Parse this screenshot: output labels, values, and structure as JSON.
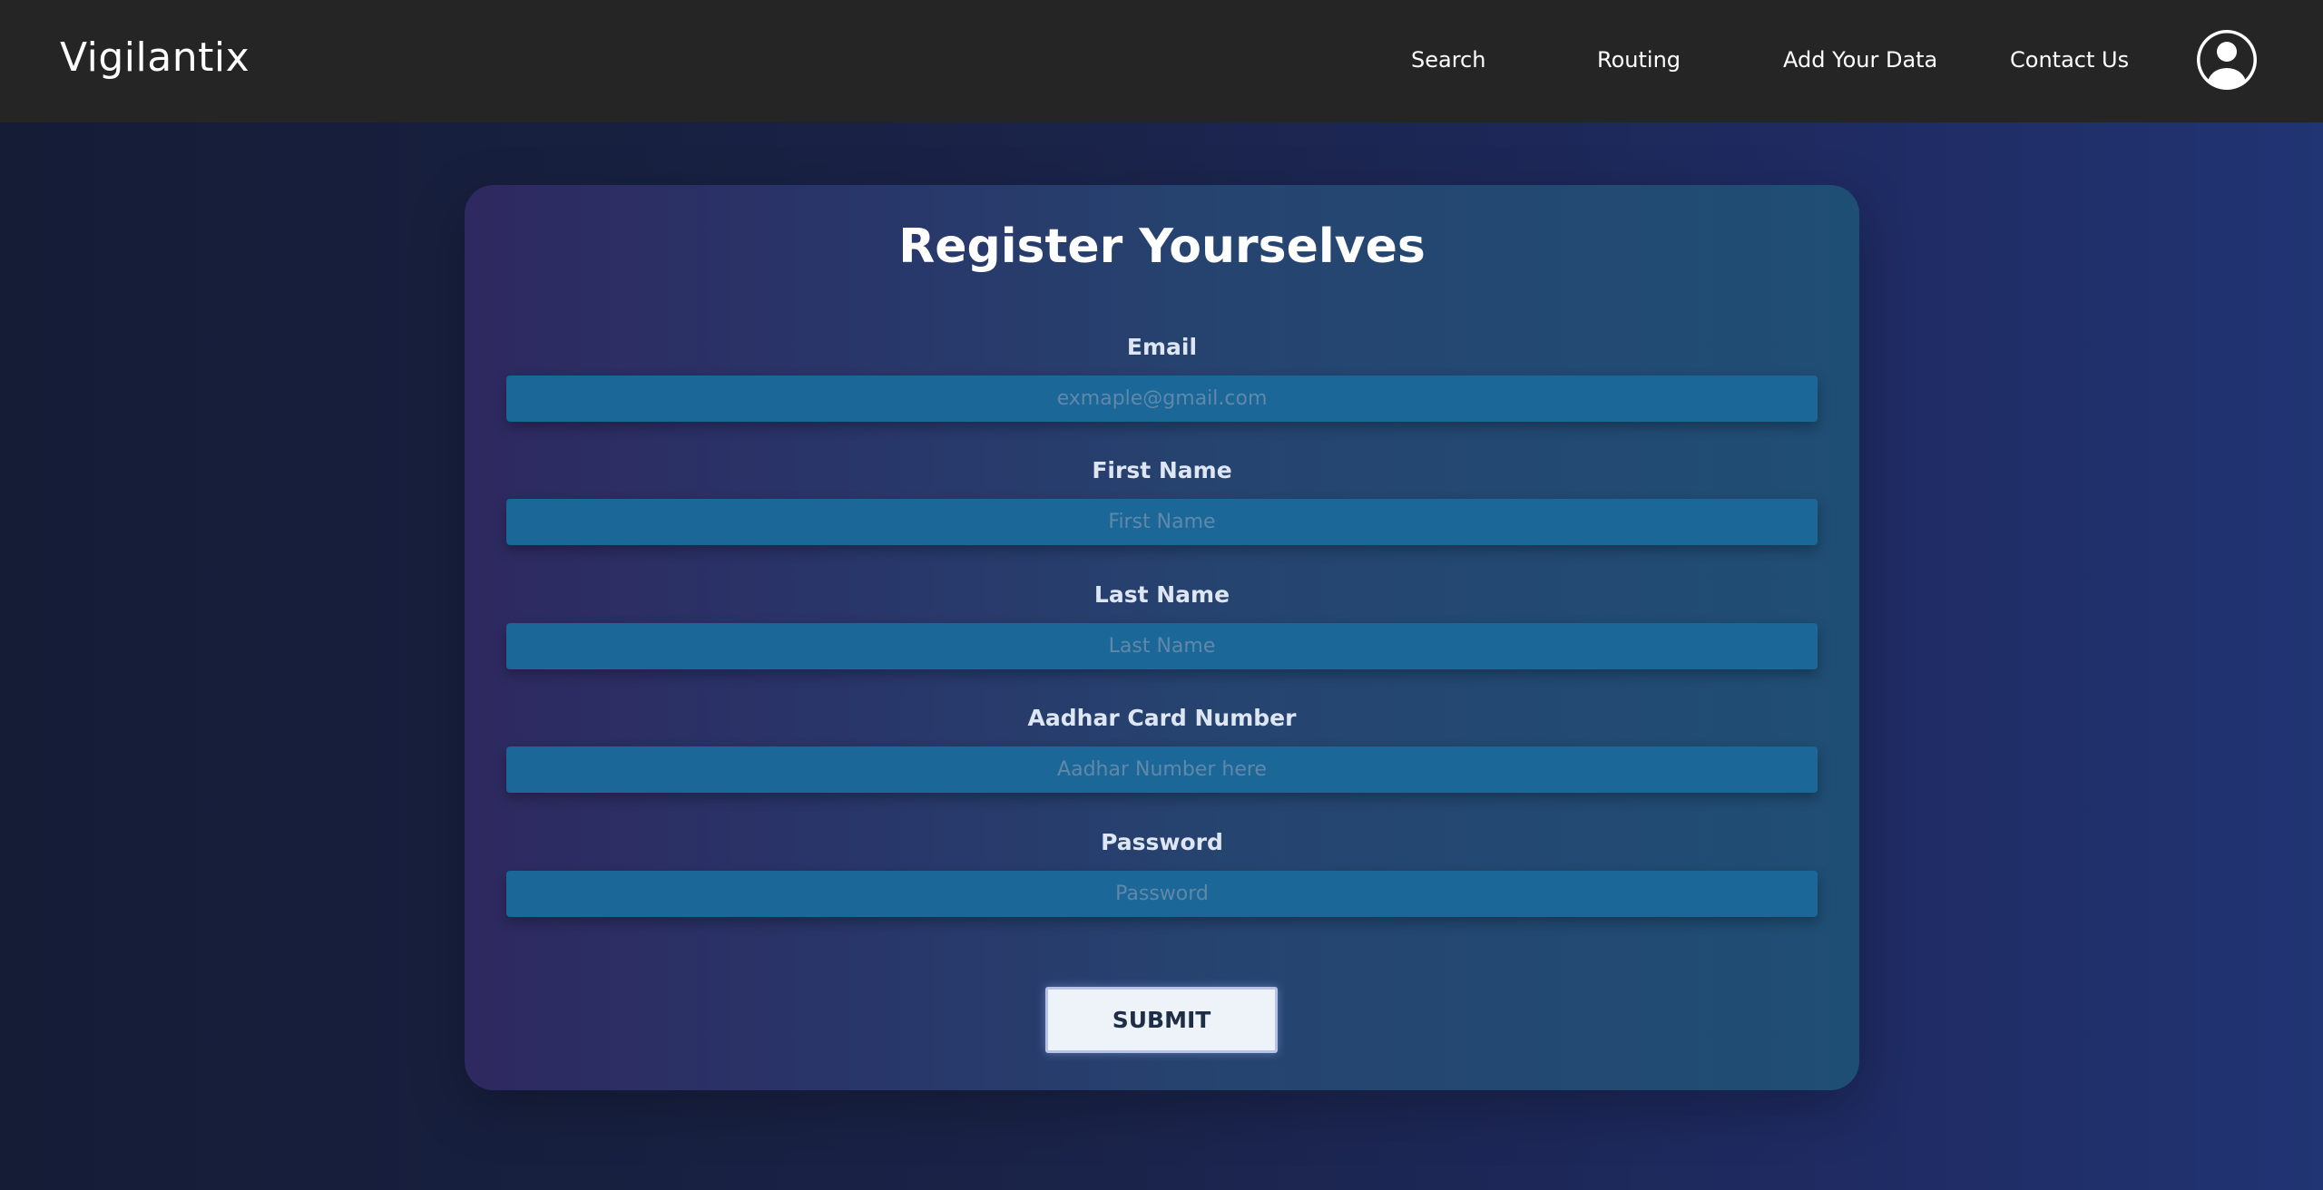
{
  "nav": {
    "brand": "Vigilantix",
    "links": [
      {
        "label": "Search"
      },
      {
        "label": "Routing"
      },
      {
        "label": "Add Your Data"
      },
      {
        "label": "Contact Us"
      }
    ],
    "avatar_icon": "user-circle-icon"
  },
  "form": {
    "title": "Register Yourselves",
    "fields": [
      {
        "label": "Email",
        "value": "",
        "placeholder": "exmaple@gmail.com"
      },
      {
        "label": "First Name",
        "value": "",
        "placeholder": "First Name"
      },
      {
        "label": "Last Name",
        "value": "",
        "placeholder": "Last Name"
      },
      {
        "label": "Aadhar Card Number",
        "value": "",
        "placeholder": "Aadhar Number here"
      },
      {
        "label": "Password",
        "value": "",
        "placeholder": "Password"
      }
    ],
    "submit_label": "SUBMIT"
  },
  "colors": {
    "navbar": "#252525",
    "input_bg": "#1b6898",
    "input_placeholder": "#5f88aa",
    "label_text": "#dde6f2",
    "button_bg": "#eef3f9",
    "button_text": "#1e2e46"
  }
}
